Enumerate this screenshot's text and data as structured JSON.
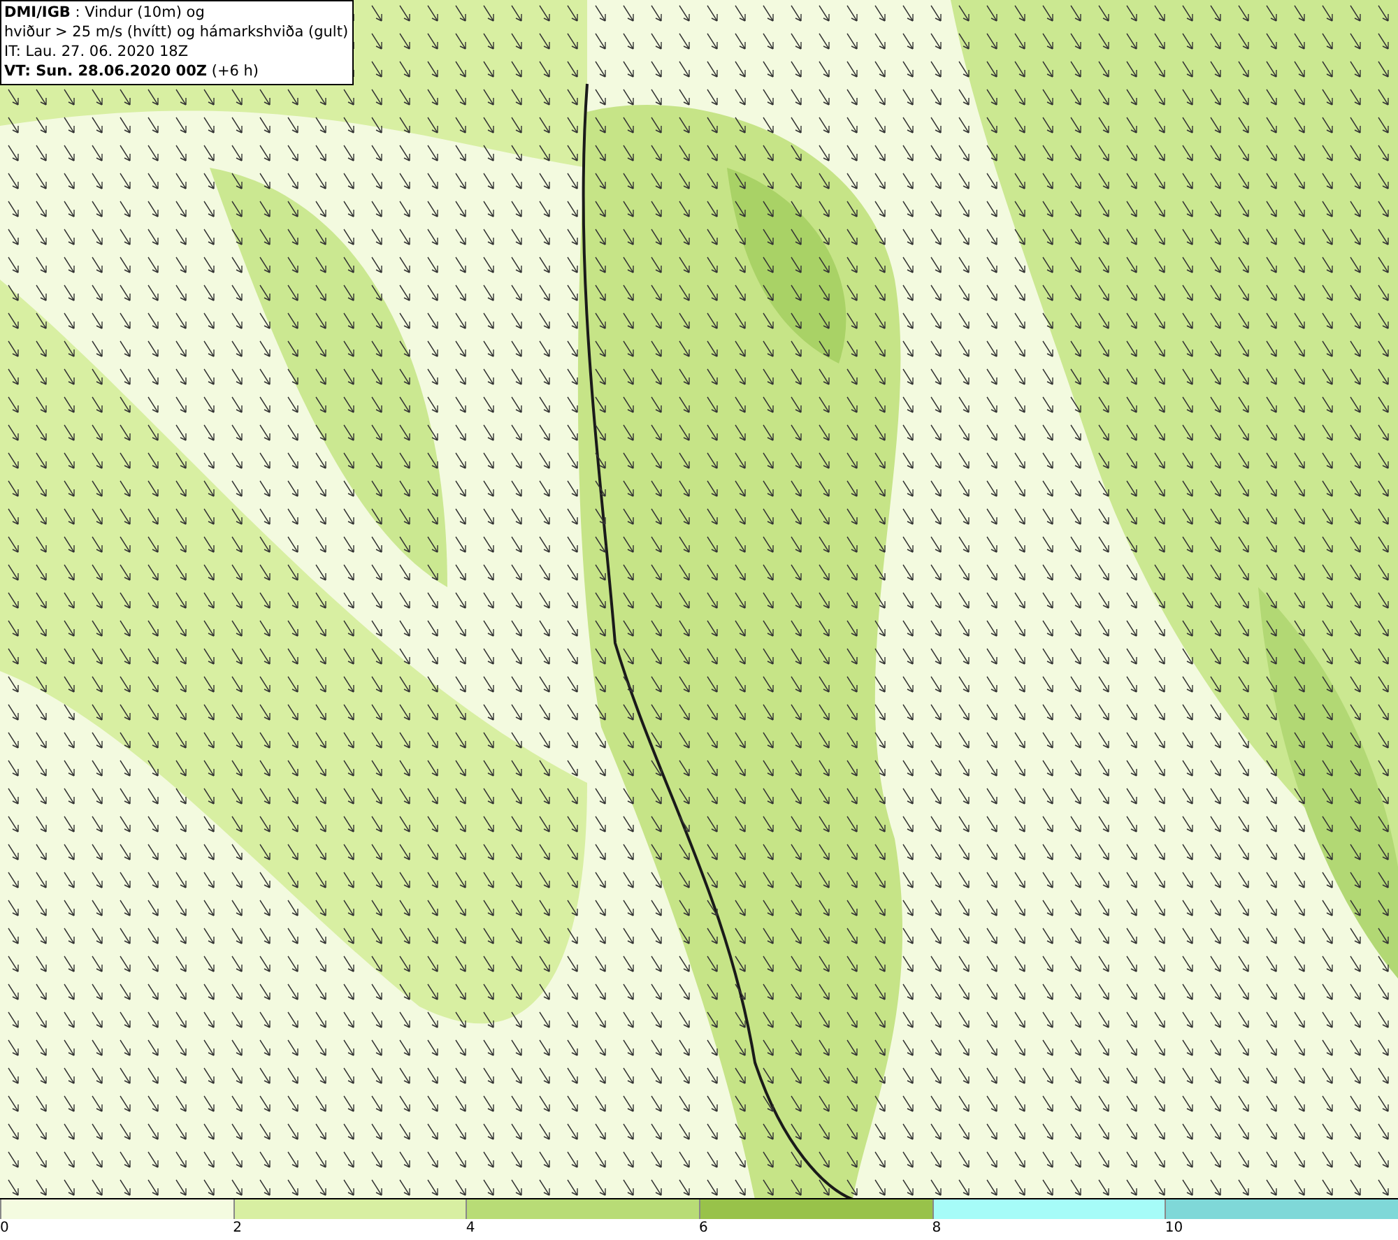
{
  "info_box": {
    "lines": [
      "**DMI/IGB** : Vindur (10m) og",
      "hviður > 25 m/s (hvítt) og hámarkshviða (gult)",
      "IT: Lau. 27. 06. 2020 18Z",
      "**VT: Sun. 28.06.2020 00Z** (+6 h)"
    ]
  },
  "colorbar": {
    "segments": [
      {
        "color": "#f4fbe0",
        "label": "0"
      },
      {
        "color": "#d8efa2",
        "label": "2"
      },
      {
        "color": "#b8dc76",
        "label": "4"
      },
      {
        "color": "#98c24a",
        "label": "6"
      },
      {
        "color": "#a6fcf8",
        "label": "8"
      },
      {
        "color": "#7fd8d8",
        "label": "10"
      }
    ]
  }
}
